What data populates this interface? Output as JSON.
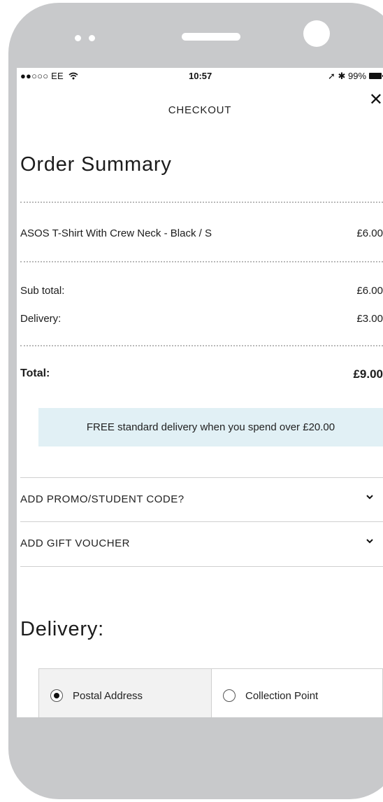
{
  "status_bar": {
    "carrier": "●●○○○ EE",
    "wifi_icon": "wifi-icon",
    "time": "10:57",
    "indicators": "➚ ✱ 99%",
    "battery_icon": "battery-icon"
  },
  "header": {
    "title": "CHECKOUT",
    "close_label": "✕"
  },
  "order_summary": {
    "heading": "Order Summary",
    "items": [
      {
        "name": "ASOS T-Shirt With Crew Neck - Black / S",
        "price": "£6.00"
      }
    ],
    "subtotal_label": "Sub total:",
    "subtotal_value": "£6.00",
    "delivery_label": "Delivery:",
    "delivery_value": "£3.00",
    "total_label": "Total:",
    "total_value": "£9.00"
  },
  "banner": {
    "text": "FREE standard delivery when you spend over £20.00",
    "color": "#e1f0f5"
  },
  "accordions": [
    {
      "label": "ADD PROMO/STUDENT CODE?",
      "icon": "chevron-down-icon"
    },
    {
      "label": "ADD GIFT VOUCHER",
      "icon": "chevron-down-icon"
    }
  ],
  "delivery": {
    "heading": "Delivery:",
    "options": [
      {
        "label": "Postal Address",
        "selected": true
      },
      {
        "label": "Collection Point",
        "selected": false
      }
    ]
  }
}
